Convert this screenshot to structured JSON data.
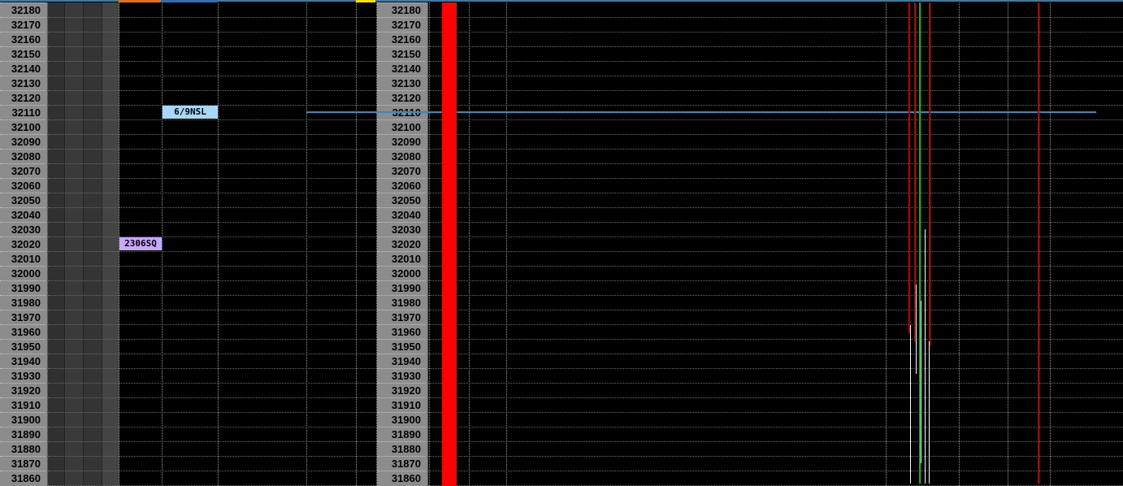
{
  "price_ticks": [
    "32180",
    "32170",
    "32160",
    "32150",
    "32140",
    "32130",
    "32120",
    "32110",
    "32100",
    "32090",
    "32080",
    "32070",
    "32060",
    "32050",
    "32040",
    "32030",
    "32020",
    "32010",
    "32000",
    "31990",
    "31980",
    "31970",
    "31960",
    "31950",
    "31940",
    "31930",
    "31920",
    "31910",
    "31900",
    "31890",
    "31880",
    "31870",
    "31860"
  ],
  "left_panel": {
    "order_tags": [
      {
        "label": "6/9NSL",
        "price": "32110",
        "color": "#a8d8f8"
      },
      {
        "label": "2306SQ",
        "price": "32020",
        "color": "#c8a8ff"
      }
    ],
    "header_markers": [
      {
        "name": "orange-marker",
        "color": "#e07020"
      },
      {
        "name": "blue-marker",
        "color": "#2f6fb0"
      },
      {
        "name": "yellow-marker",
        "color": "#ffe000"
      }
    ]
  },
  "chart": {
    "reference_line_price": "32110",
    "reference_line_color": "#2a8fc8",
    "highlight_band_color": "#ff0000",
    "trace_colors": {
      "red": "#c00000",
      "green": "#00c000",
      "white": "#ffffff"
    }
  }
}
